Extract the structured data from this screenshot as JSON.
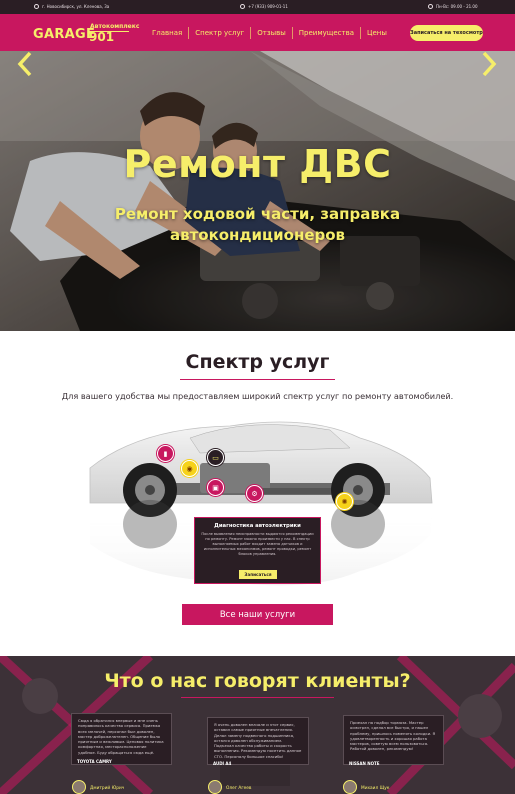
{
  "topbar": {
    "address": "г. Новосибирск, ул. Кленова, 3а",
    "phone": "+7 (933) 909-01-11",
    "hours": "Пн-Вс: 09.00 - 21.00"
  },
  "nav": {
    "logo": {
      "garage": "GARAGE",
      "subtitle": "Автокомплекс",
      "number": "901"
    },
    "items": [
      "Главная",
      "Спектр услуг",
      "Отзывы",
      "Преимущества",
      "Цены"
    ],
    "cta": "Записаться на техосмотр"
  },
  "hero": {
    "title": "Ремонт ДВС",
    "subtitle": "Ремонт ходовой части, заправка автокондиционеров"
  },
  "services": {
    "title": "Спектр услуг",
    "description": "Для вашего удобства мы предоставляем широкий спектр услуг по ремонту автомобилей.",
    "tooltip": {
      "title": "Диагностика автоэлектрики",
      "text": "После выявления неисправности выдаются рекомендации по ремонту. Ремонт можно произвести у нас. В спектр выполняемых работ входит замена датчиков и исполнительных механизмов, ремонт проводки, ремонт блоков управления.",
      "button": "Записаться"
    },
    "all_button": "Все наши услуги"
  },
  "reviews": {
    "title": "Что о нас говорят клиенты?",
    "items": [
      {
        "text": "Сюда я обратился впервые и мне очень понравилось качество сервиса. Приемка всех мелочей, персонал был доволен, мастер доброжелателен. Общение было приятным и вежливым. Ценовая политика комфортная, месторасположение удобное. Буду обращаться сюда ещё.",
        "car": "TOYOTA CAMRY",
        "author": "Дмитрий Юрич"
      },
      {
        "text": "Я очень доволен вначале и этот сервис, оставил самые приятные впечатления. Делал замену подвесного подшипника, остался доволен обслуживанием. Подъехал качество работы и скорость выполнения. Рекомендую посетить данное СТО. Персоналу большое спасибо!",
        "car": "AUDI A4",
        "author": "Олег Агеев"
      },
      {
        "text": "Приехал на подбор тормоза. Мастер осмотрел, сделал все быстро, и нашел проблему, пришлось поменять колодки. Я удовлетворенность и хорошая работа мастеров, советую всем пользоваться. Работой доволен, рекомендую!",
        "car": "NISSAN NOTE",
        "author": "Михаил Щук"
      }
    ]
  },
  "colors": {
    "brand": "#c8175f",
    "accent": "#f6ee6a",
    "dark": "#2a1e24"
  }
}
